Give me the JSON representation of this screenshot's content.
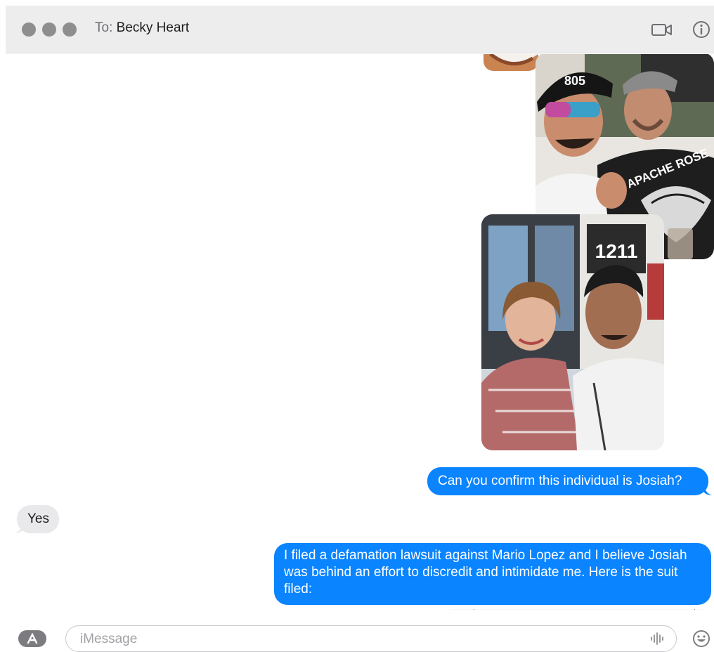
{
  "header": {
    "to_label": "To:",
    "recipient": "Becky Heart",
    "facetime_icon": "video-camera-icon",
    "info_icon": "info-circle-icon"
  },
  "photos": {
    "photo1": {
      "cap_text": "805",
      "shirt_text": "APACHE ROSE"
    },
    "photo2": {
      "sign_text": "1211"
    }
  },
  "messages": [
    {
      "direction": "outgoing",
      "text": "Can you confirm this individual is Josiah?"
    },
    {
      "direction": "incoming",
      "text": "Yes"
    },
    {
      "direction": "outgoing",
      "text": "I filed a defamation lawsuit against Mario Lopez and I believe Josiah was behind an effort to discredit and intimidate me. Here is the suit filed:"
    }
  ],
  "composer": {
    "placeholder": "iMessage",
    "value": "",
    "apps_icon": "app-store-icon",
    "audio_icon": "audio-waveform-icon",
    "emoji_icon": "emoji-smile-icon"
  },
  "colors": {
    "outgoing_bubble": "#0a84ff",
    "incoming_bubble": "#e9e9eb",
    "titlebar": "#ededed"
  }
}
